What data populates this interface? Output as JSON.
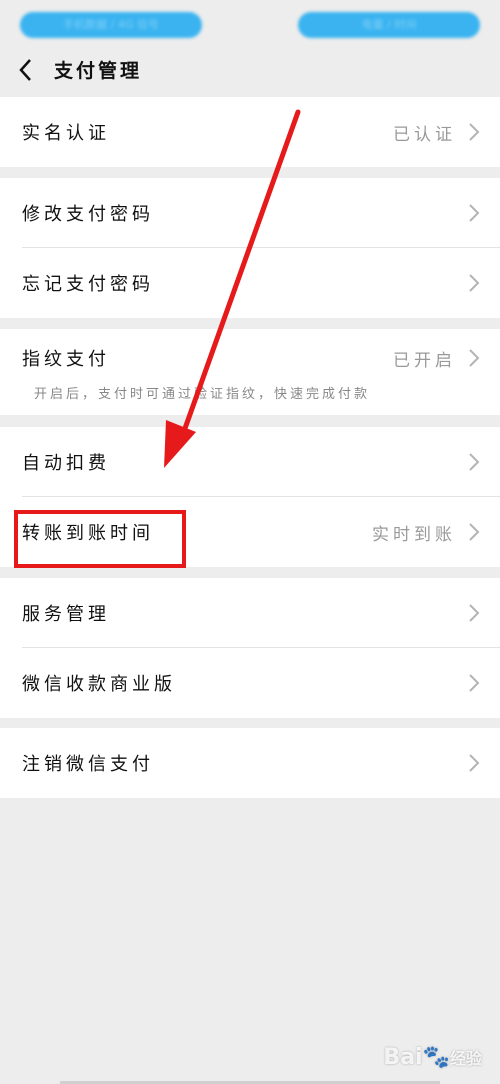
{
  "status_bar": {
    "left_pill": "手机数据 / 4G 信号",
    "right_pill": "电量 / 时间"
  },
  "header": {
    "title": "支付管理"
  },
  "groups": [
    {
      "rows": [
        {
          "label": "实名认证",
          "value": "已认证"
        }
      ]
    },
    {
      "rows": [
        {
          "label": "修改支付密码",
          "value": ""
        },
        {
          "label": "忘记支付密码",
          "value": ""
        }
      ]
    },
    {
      "rows": [
        {
          "label": "指纹支付",
          "value": "已开启",
          "sub": "开启后，支付时可通过验证指纹，快速完成付款"
        }
      ]
    },
    {
      "rows": [
        {
          "label": "自动扣费",
          "value": ""
        },
        {
          "label": "转账到账时间",
          "value": "实时到账"
        }
      ]
    },
    {
      "rows": [
        {
          "label": "服务管理",
          "value": ""
        },
        {
          "label": "微信收款商业版",
          "value": ""
        }
      ]
    },
    {
      "rows": [
        {
          "label": "注销微信支付",
          "value": ""
        }
      ]
    }
  ],
  "watermark": {
    "brand": "Bai",
    "suffix": "经验"
  },
  "colors": {
    "background": "#ededed",
    "annotation_red": "#e61a1a",
    "status_pill": "#3ab3f0"
  }
}
